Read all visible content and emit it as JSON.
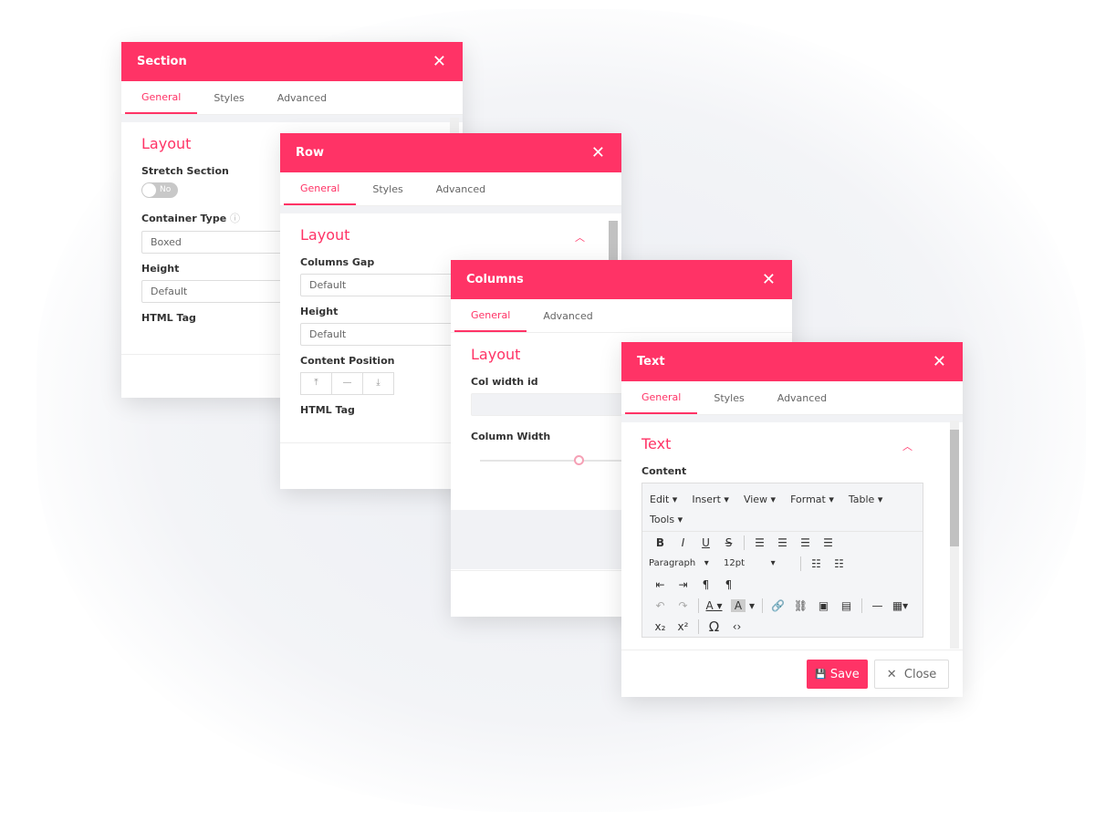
{
  "colors": {
    "accent": "#ff3366"
  },
  "section": {
    "title": "Section",
    "tabs": [
      "General",
      "Styles",
      "Advanced"
    ],
    "heading": "Layout",
    "stretch_label": "Stretch Section",
    "stretch_value": "No",
    "container_label": "Container Type",
    "container_value": "Boxed",
    "height_label": "Height",
    "height_value": "Default",
    "tag_label": "HTML Tag"
  },
  "row": {
    "title": "Row",
    "tabs": [
      "General",
      "Styles",
      "Advanced"
    ],
    "heading": "Layout",
    "gap_label": "Columns Gap",
    "gap_value": "Default",
    "height_label": "Height",
    "height_value": "Default",
    "position_label": "Content Position",
    "tag_label": "HTML Tag"
  },
  "columns": {
    "title": "Columns",
    "tabs": [
      "General",
      "Advanced"
    ],
    "heading": "Layout",
    "colid_label": "Col width id",
    "colid_value": "",
    "width_label": "Column Width"
  },
  "text": {
    "title": "Text",
    "tabs": [
      "General",
      "Styles",
      "Advanced"
    ],
    "heading": "Text",
    "content_label": "Content",
    "menus": [
      "Edit",
      "Insert",
      "View",
      "Format",
      "Table",
      "Tools"
    ],
    "block_format": "Paragraph",
    "font_size": "12pt",
    "save": "Save",
    "close": "Close"
  }
}
